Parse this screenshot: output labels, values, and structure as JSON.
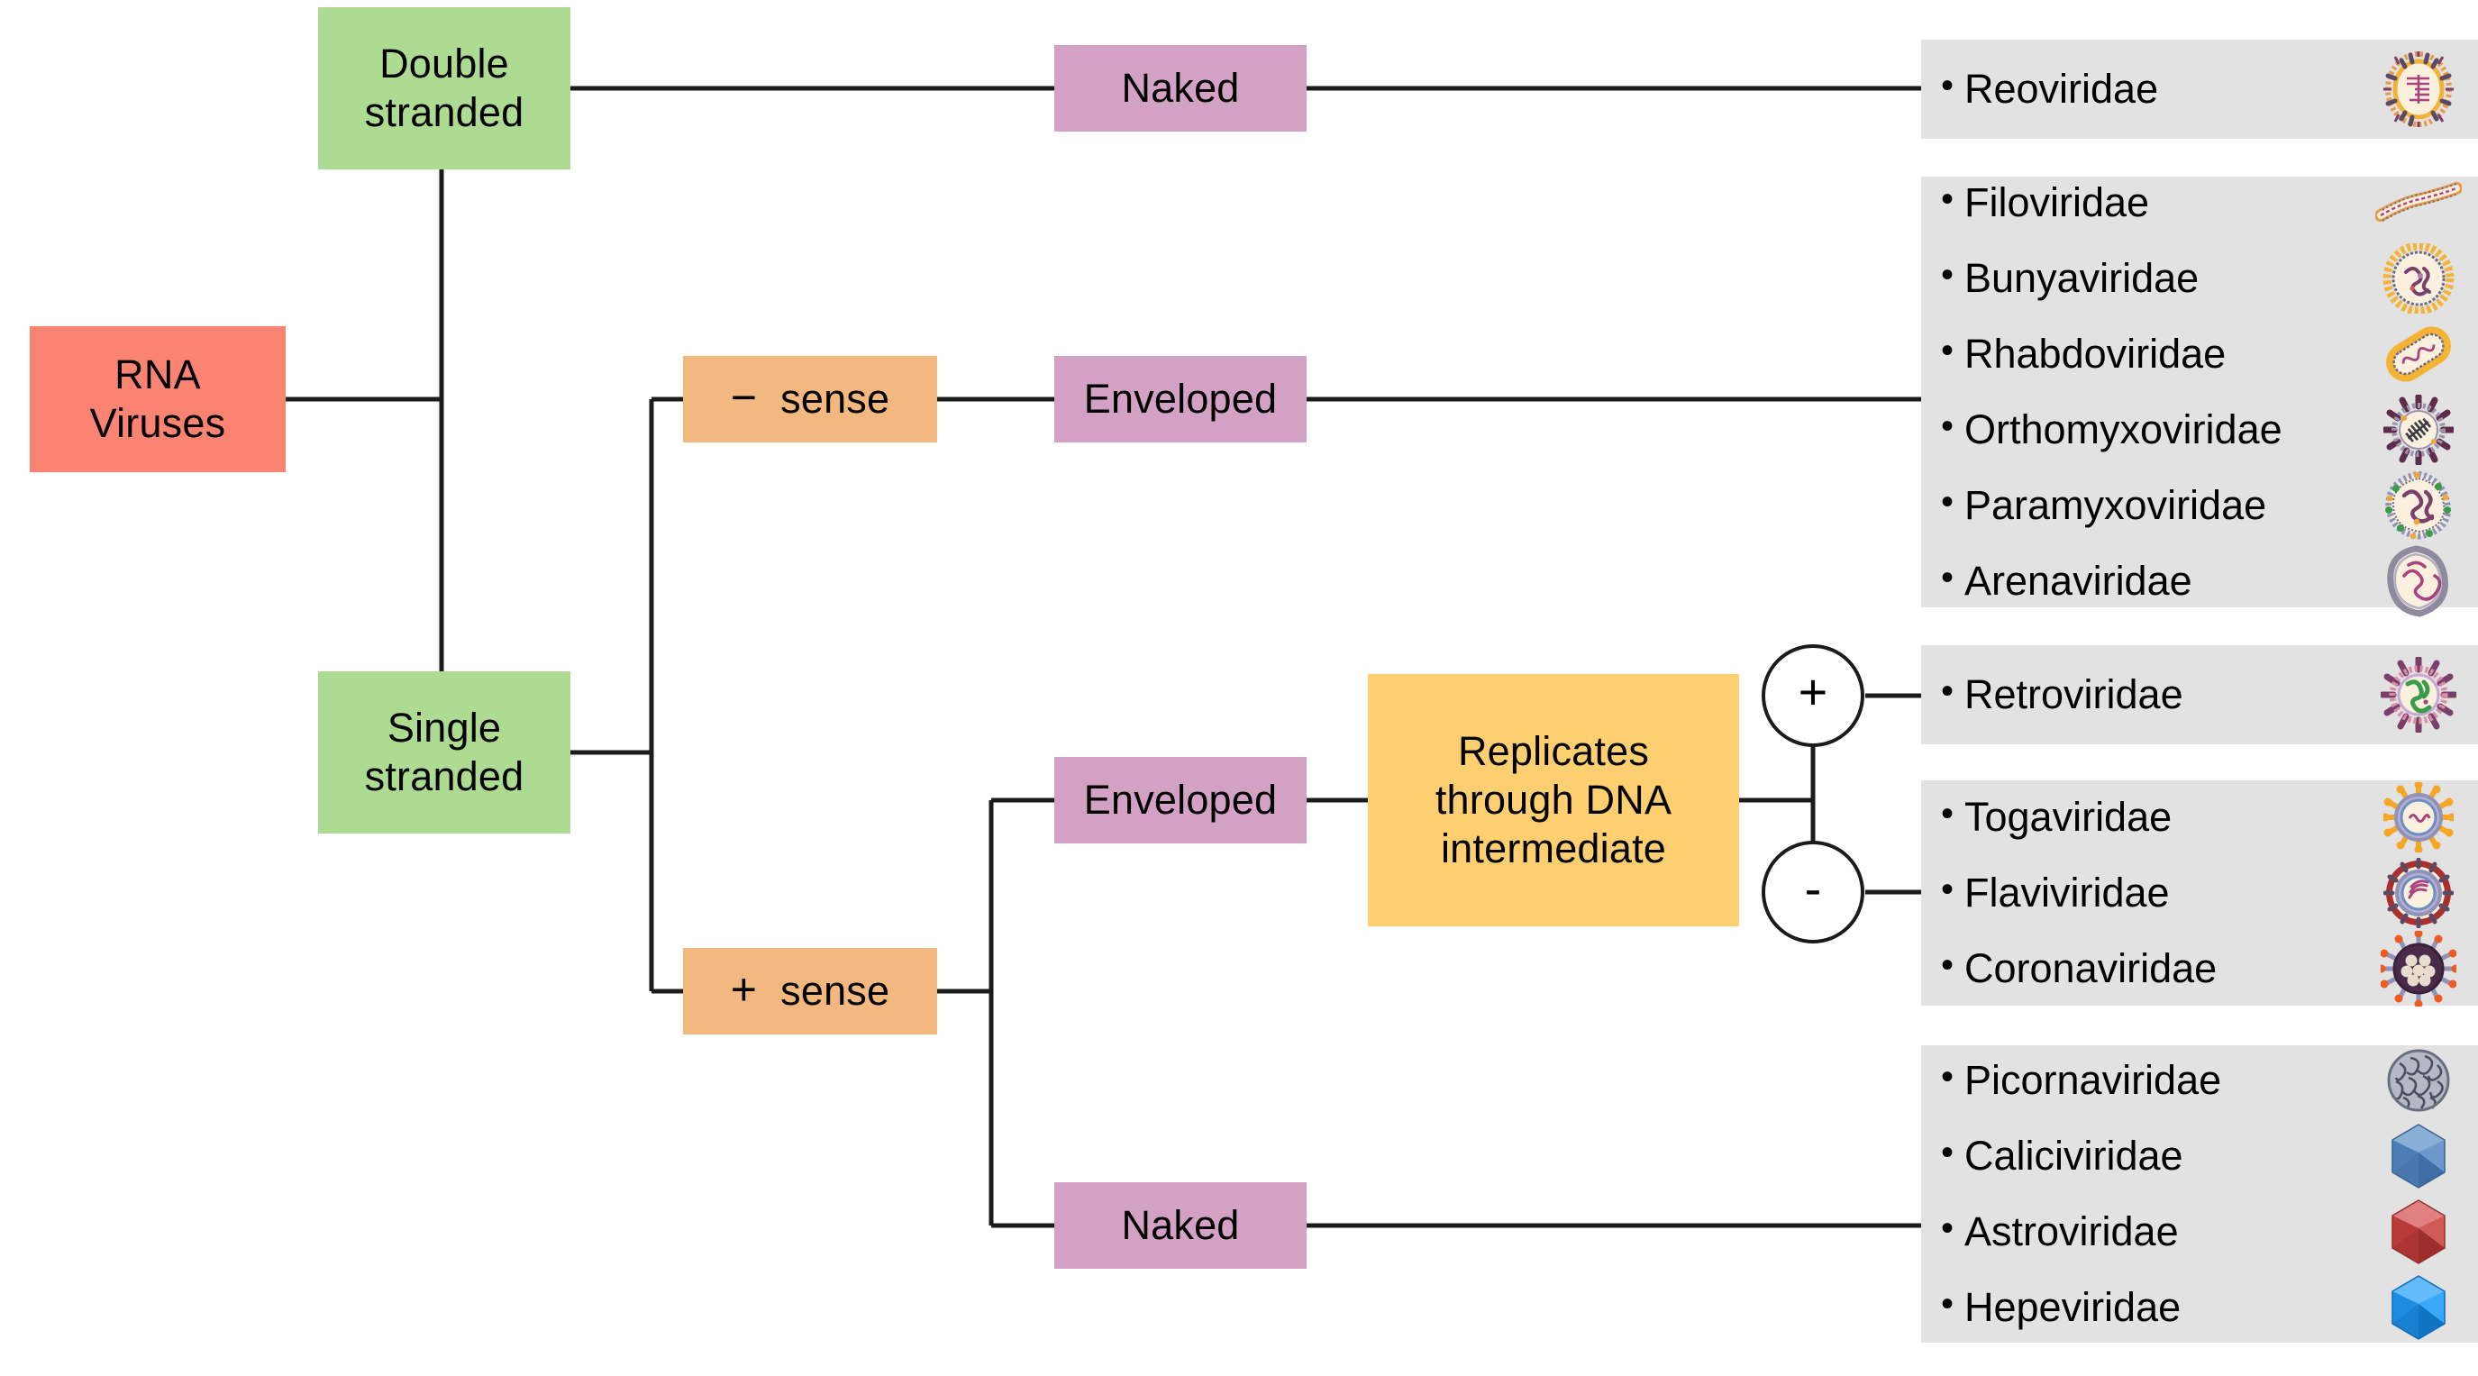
{
  "diagram": {
    "title": "RNA Viruses classification flowchart",
    "colors": {
      "root": "#fb8372",
      "strandedness": "#aedb92",
      "envelope": "#d3a1c3",
      "sense": "#f2b87f",
      "replication": "#fecf71",
      "panel": "#e2e2e2",
      "line": "#1b1b1b"
    }
  },
  "nodes": {
    "root": {
      "label": "RNA\nViruses"
    },
    "double_stranded": {
      "label": "Double\nstranded"
    },
    "single_stranded": {
      "label": "Single\nstranded"
    },
    "ds_naked": {
      "label": "Naked"
    },
    "neg_sense": {
      "symbol": "−",
      "word": "sense"
    },
    "pos_sense": {
      "symbol": "+",
      "word": "sense"
    },
    "neg_enveloped": {
      "label": "Enveloped"
    },
    "pos_enveloped": {
      "label": "Enveloped"
    },
    "pos_naked": {
      "label": "Naked"
    },
    "replicates": {
      "label": "Replicates\nthrough DNA\nintermediate"
    },
    "retro_plus": {
      "label": "+"
    },
    "retro_minus": {
      "label": "-"
    }
  },
  "panels": [
    {
      "id": "panel-dsrna-naked",
      "items": [
        {
          "name": "Reoviridae",
          "bullet": "•",
          "icon": "reoviridae-icon"
        }
      ]
    },
    {
      "id": "panel-negsense-enveloped",
      "items": [
        {
          "name": "Filoviridae",
          "bullet": "•",
          "icon": "filoviridae-icon"
        },
        {
          "name": "Bunyaviridae",
          "bullet": "•",
          "icon": "bunyaviridae-icon"
        },
        {
          "name": "Rhabdoviridae",
          "bullet": "•",
          "icon": "rhabdoviridae-icon"
        },
        {
          "name": "Orthomyxoviridae",
          "bullet": "•",
          "icon": "orthomyxoviridae-icon"
        },
        {
          "name": "Paramyxoviridae",
          "bullet": "•",
          "icon": "paramyxoviridae-icon"
        },
        {
          "name": "Arenaviridae",
          "bullet": "•",
          "icon": "arenaviridae-icon"
        }
      ]
    },
    {
      "id": "panel-retro",
      "items": [
        {
          "name": "Retroviridae",
          "bullet": "•",
          "icon": "retroviridae-icon"
        }
      ]
    },
    {
      "id": "panel-possense-enveloped",
      "items": [
        {
          "name": "Togaviridae",
          "bullet": "•",
          "icon": "togaviridae-icon"
        },
        {
          "name": "Flaviviridae",
          "bullet": "•",
          "icon": "flaviviridae-icon"
        },
        {
          "name": "Coronaviridae",
          "bullet": "•",
          "icon": "coronaviridae-icon"
        }
      ]
    },
    {
      "id": "panel-possense-naked",
      "items": [
        {
          "name": "Picornaviridae",
          "bullet": "•",
          "icon": "picornaviridae-icon"
        },
        {
          "name": "Caliciviridae",
          "bullet": "•",
          "icon": "caliciviridae-icon"
        },
        {
          "name": "Astroviridae",
          "bullet": "•",
          "icon": "astroviridae-icon"
        },
        {
          "name": "Hepeviridae",
          "bullet": "•",
          "icon": "hepeviridae-icon"
        }
      ]
    }
  ]
}
